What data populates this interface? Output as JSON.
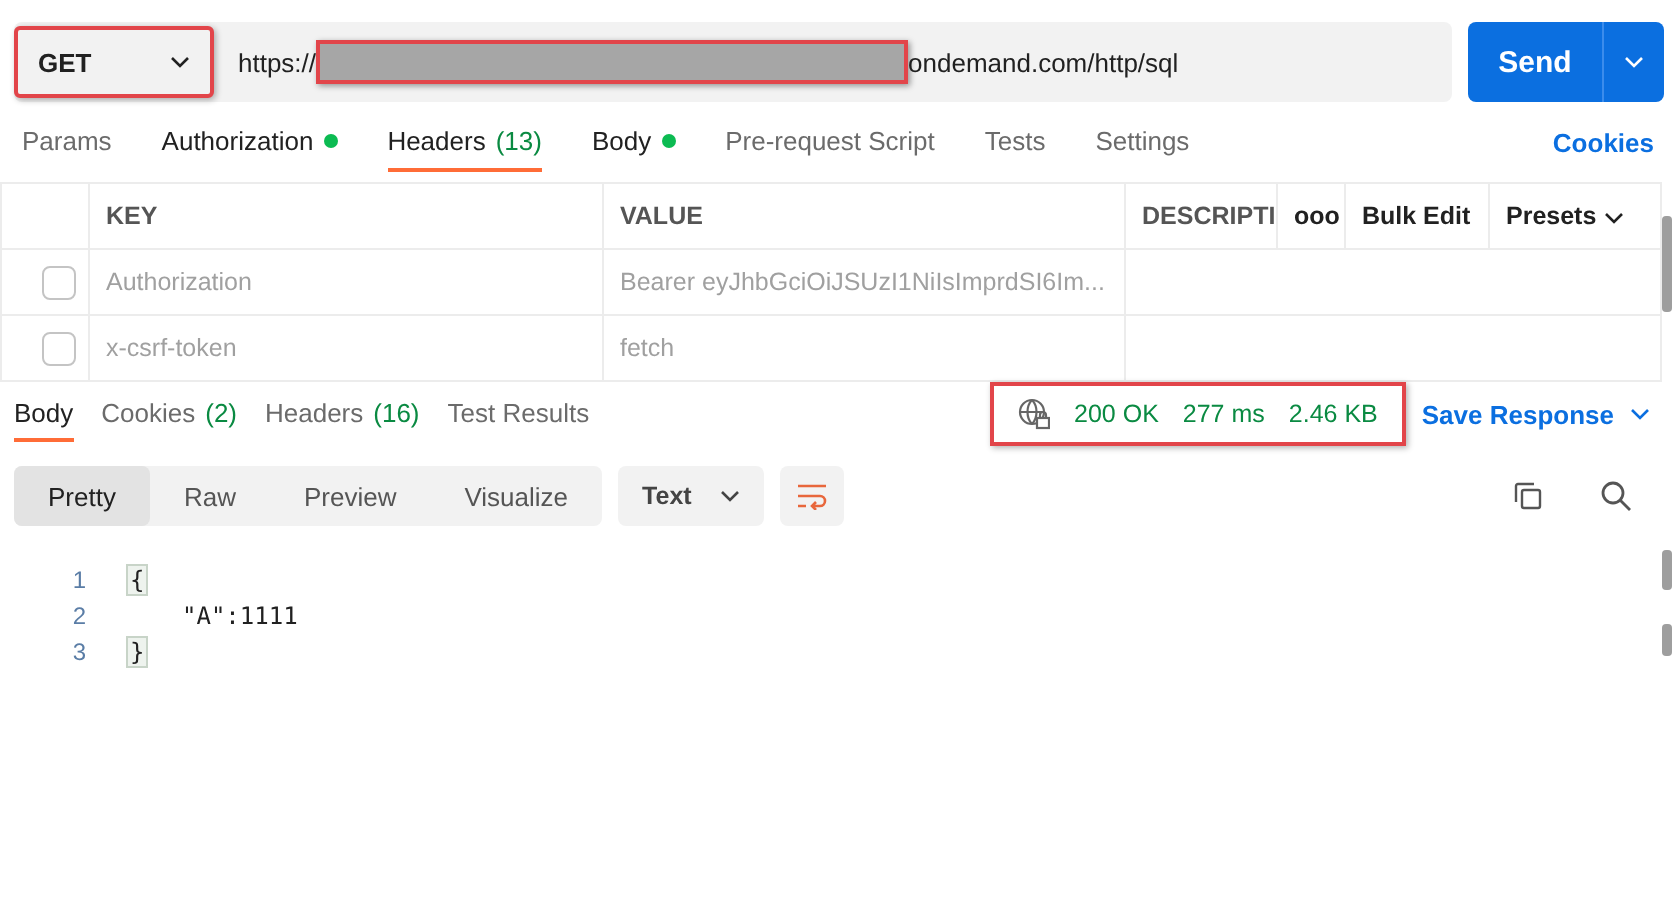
{
  "request": {
    "method": "GET",
    "method_highlighted": true,
    "url_prefix": "https://",
    "url_redacted": true,
    "url_suffix": "ondemand.com/http/sql",
    "send": "Send"
  },
  "request_tabs": [
    {
      "label": "Params",
      "selected": false
    },
    {
      "label": "Authorization",
      "selected": false,
      "dot": true
    },
    {
      "label": "Headers",
      "count": "(13)",
      "selected": true
    },
    {
      "label": "Body",
      "selected": false,
      "dot": true
    },
    {
      "label": "Pre-request Script",
      "selected": false
    },
    {
      "label": "Tests",
      "selected": false
    },
    {
      "label": "Settings",
      "selected": false
    }
  ],
  "cookies_link": "Cookies",
  "headers_table": {
    "columns": [
      "KEY",
      "VALUE",
      "DESCRIPTI"
    ],
    "more": "ooo",
    "bulk_edit": "Bulk Edit",
    "presets": "Presets",
    "rows": [
      {
        "checked": false,
        "key": "Authorization",
        "value": "Bearer eyJhbGciOiJSUzI1NiIsImprdSI6Im..."
      },
      {
        "checked": false,
        "key": "x-csrf-token",
        "value": "fetch"
      }
    ]
  },
  "response_tabs": [
    {
      "label": "Body",
      "selected": true
    },
    {
      "label": "Cookies",
      "count": "(2)",
      "selected": false
    },
    {
      "label": "Headers",
      "count": "(16)",
      "selected": false
    },
    {
      "label": "Test Results",
      "selected": false
    }
  ],
  "response_status": {
    "highlighted": true,
    "status": "200 OK",
    "time": "277 ms",
    "size": "2.46 KB"
  },
  "save_response": "Save Response",
  "view_modes": [
    {
      "label": "Pretty",
      "selected": true
    },
    {
      "label": "Raw",
      "selected": false
    },
    {
      "label": "Preview",
      "selected": false
    },
    {
      "label": "Visualize",
      "selected": false
    }
  ],
  "format": "Text",
  "code_lines": [
    {
      "number": "1",
      "text": "{"
    },
    {
      "number": "2",
      "text": "\"A\":1111"
    },
    {
      "number": "3",
      "text": "}"
    }
  ]
}
